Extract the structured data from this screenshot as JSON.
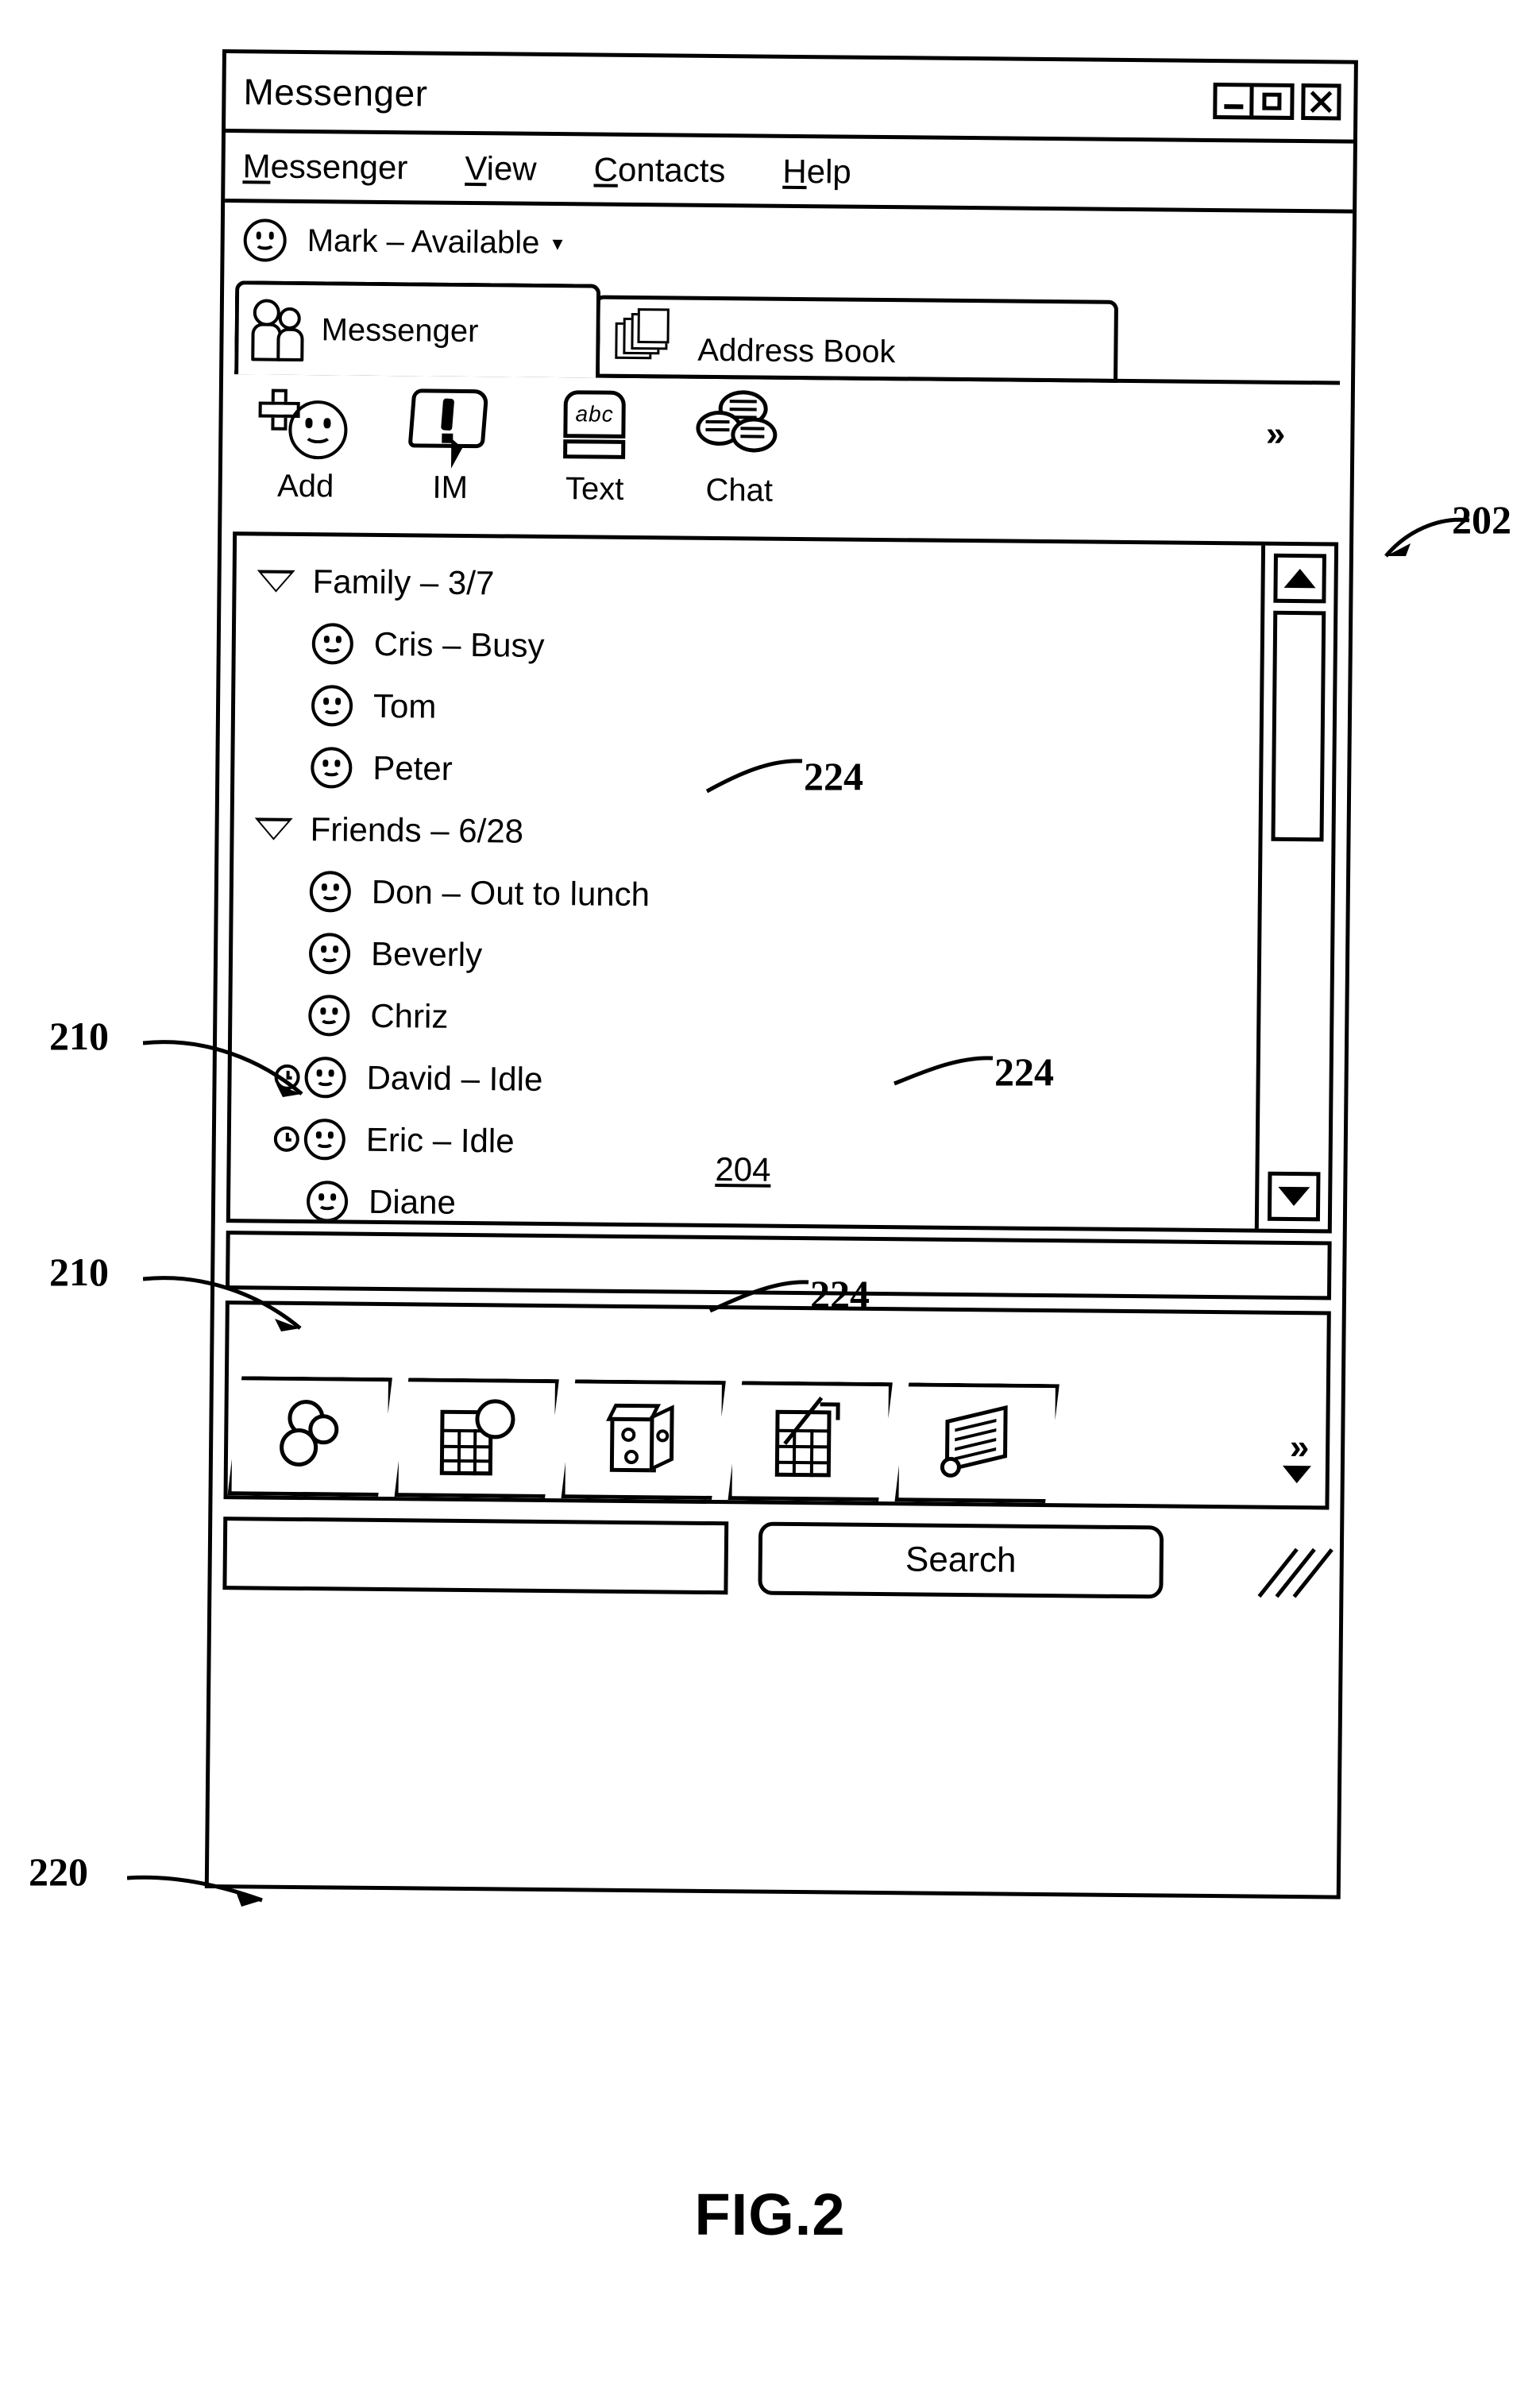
{
  "figure": {
    "caption": "FIG.2",
    "reference_numerals": [
      {
        "id": "202",
        "label": "202"
      },
      {
        "id": "204",
        "label": "204"
      },
      {
        "id": "210a",
        "label": "210"
      },
      {
        "id": "210b",
        "label": "210"
      },
      {
        "id": "220",
        "label": "220"
      },
      {
        "id": "224a",
        "label": "224"
      },
      {
        "id": "224b",
        "label": "224"
      },
      {
        "id": "224c",
        "label": "224"
      }
    ]
  },
  "window": {
    "title": "Messenger",
    "controls": {
      "minimize": "minimize-icon",
      "maximize": "maximize-icon",
      "close": "close-icon"
    }
  },
  "menubar": {
    "items": [
      {
        "mnemonic": "M",
        "rest": "essenger"
      },
      {
        "mnemonic": "V",
        "rest": "iew"
      },
      {
        "mnemonic": "C",
        "rest": "ontacts"
      },
      {
        "mnemonic": "H",
        "rest": "elp"
      }
    ]
  },
  "status": {
    "icon": "smiley-icon",
    "text": "Mark  –  Available",
    "dropdown_caret": "▾"
  },
  "tabs": [
    {
      "label": "Messenger",
      "icon": "two-people-icon",
      "active": true
    },
    {
      "label": "Address Book",
      "icon": "card-file-icon",
      "active": false
    }
  ],
  "toolbar": {
    "buttons": [
      {
        "label": "Add",
        "icon": "add-contact-icon"
      },
      {
        "label": "IM",
        "icon": "instant-message-icon"
      },
      {
        "label": "Text",
        "icon": "text-message-icon"
      },
      {
        "label": "Chat",
        "icon": "chat-icon"
      }
    ],
    "overflow": "»",
    "text_icon_letters": "abc"
  },
  "contact_list": {
    "reference": "204",
    "groups": [
      {
        "name": "Family  –  3/7",
        "expanded": true,
        "contacts": [
          {
            "name": "Cris  –  Busy",
            "presence": "smiley-icon",
            "idle": false
          },
          {
            "name": "Tom",
            "presence": "smiley-icon",
            "idle": false
          },
          {
            "name": "Peter",
            "presence": "smiley-icon",
            "idle": false
          }
        ]
      },
      {
        "name": "Friends  –  6/28",
        "expanded": true,
        "contacts": [
          {
            "name": "Don  –  Out to lunch",
            "presence": "smiley-icon",
            "idle": false
          },
          {
            "name": "Beverly",
            "presence": "smiley-icon",
            "idle": false
          },
          {
            "name": "Chriz",
            "presence": "smiley-icon",
            "idle": false
          },
          {
            "name": "David  –  Idle",
            "presence": "smiley-icon",
            "idle": true
          },
          {
            "name": "Eric  –  Idle",
            "presence": "smiley-icon",
            "idle": true
          },
          {
            "name": "Diane",
            "presence": "smiley-icon",
            "idle": false
          }
        ]
      }
    ],
    "scrollbar": {
      "up_arrow": "▲",
      "down_arrow": "▼"
    }
  },
  "games_panel": {
    "reference": "220",
    "tabs": [
      {
        "icon": "balls-icon"
      },
      {
        "icon": "calendar-disc-icon"
      },
      {
        "icon": "dice-icon"
      },
      {
        "icon": "chart-grid-icon"
      },
      {
        "icon": "newspaper-scroll-icon"
      }
    ],
    "overflow": "»",
    "more_caret": "▼"
  },
  "search": {
    "input_value": "",
    "button_label": "Search",
    "resize_grip": "resize-grip-icon"
  }
}
